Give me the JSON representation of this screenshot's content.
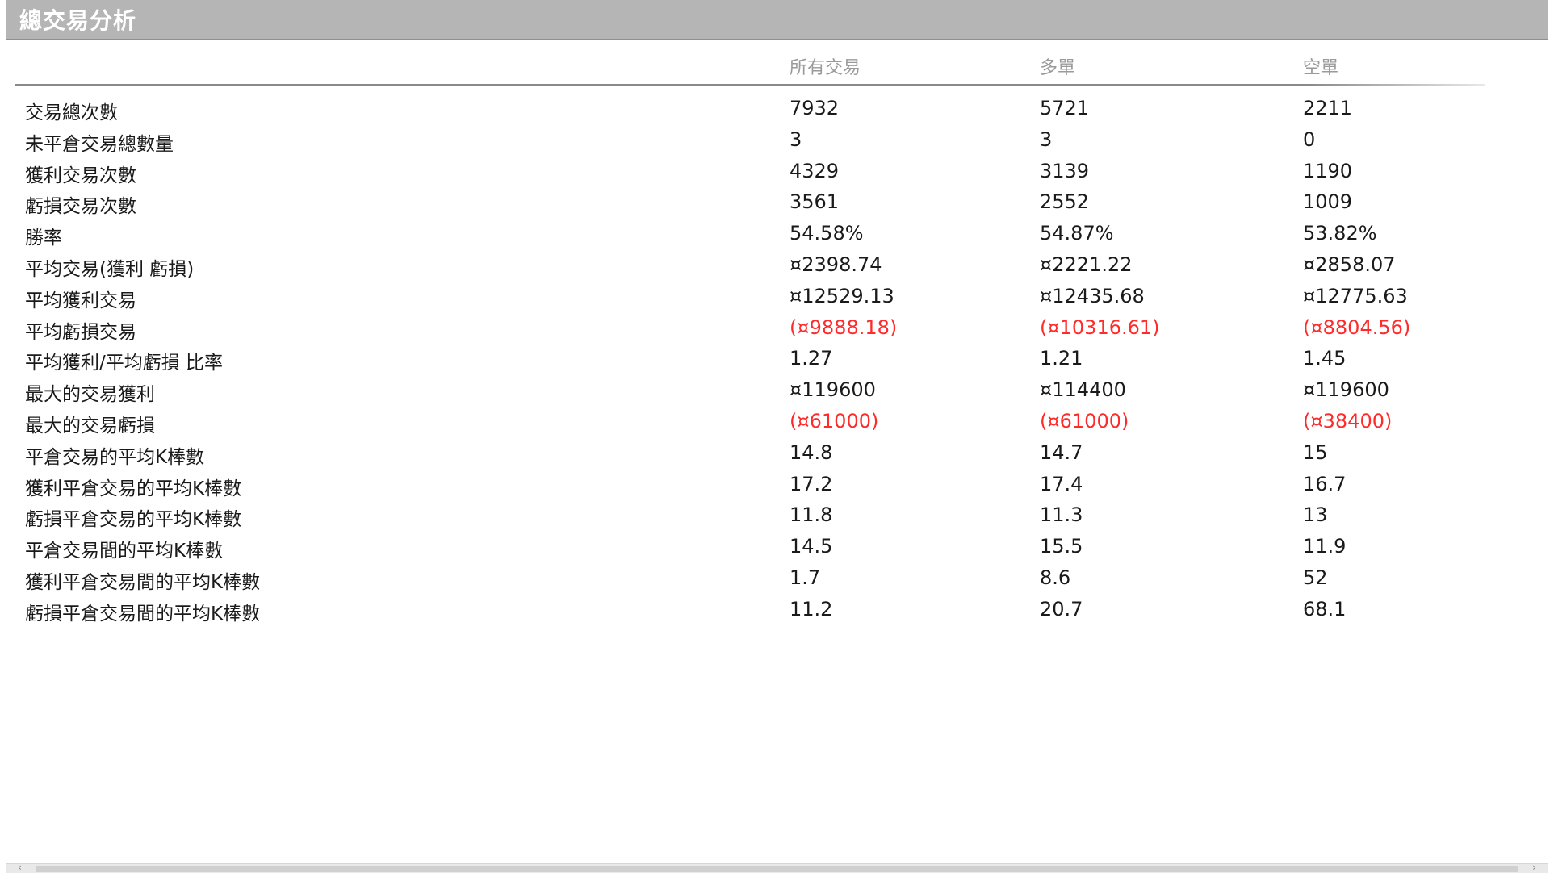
{
  "window": {
    "title": "總交易分析"
  },
  "table": {
    "headers": [
      "",
      "所有交易",
      "多單",
      "空單"
    ],
    "rows": [
      {
        "label": "交易總次數",
        "values": [
          "7932",
          "5721",
          "2211"
        ],
        "negative": false
      },
      {
        "label": "未平倉交易總數量",
        "values": [
          "3",
          "3",
          "0"
        ],
        "negative": false
      },
      {
        "label": "獲利交易次數",
        "values": [
          "4329",
          "3139",
          "1190"
        ],
        "negative": false
      },
      {
        "label": "虧損交易次數",
        "values": [
          "3561",
          "2552",
          "1009"
        ],
        "negative": false
      },
      {
        "label": "勝率",
        "values": [
          "54.58%",
          "54.87%",
          "53.82%"
        ],
        "negative": false
      },
      {
        "label": "平均交易(獲利 虧損)",
        "values": [
          "¤2398.74",
          "¤2221.22",
          "¤2858.07"
        ],
        "negative": false
      },
      {
        "label": "平均獲利交易",
        "values": [
          "¤12529.13",
          "¤12435.68",
          "¤12775.63"
        ],
        "negative": false
      },
      {
        "label": "平均虧損交易",
        "values": [
          "(¤9888.18)",
          "(¤10316.61)",
          "(¤8804.56)"
        ],
        "negative": true
      },
      {
        "label": "平均獲利/平均虧損 比率",
        "values": [
          "1.27",
          "1.21",
          "1.45"
        ],
        "negative": false
      },
      {
        "label": "最大的交易獲利",
        "values": [
          "¤119600",
          "¤114400",
          "¤119600"
        ],
        "negative": false
      },
      {
        "label": "最大的交易虧損",
        "values": [
          "(¤61000)",
          "(¤61000)",
          "(¤38400)"
        ],
        "negative": true
      },
      {
        "label": "平倉交易的平均K棒數",
        "values": [
          "14.8",
          "14.7",
          "15"
        ],
        "negative": false
      },
      {
        "label": "獲利平倉交易的平均K棒數",
        "values": [
          "17.2",
          "17.4",
          "16.7"
        ],
        "negative": false
      },
      {
        "label": "虧損平倉交易的平均K棒數",
        "values": [
          "11.8",
          "11.3",
          "13"
        ],
        "negative": false
      },
      {
        "label": "平倉交易間的平均K棒數",
        "values": [
          "14.5",
          "15.5",
          "11.9"
        ],
        "negative": false
      },
      {
        "label": "獲利平倉交易間的平均K棒數",
        "values": [
          "1.7",
          "8.6",
          "52"
        ],
        "negative": false
      },
      {
        "label": "虧損平倉交易間的平均K棒數",
        "values": [
          "11.2",
          "20.7",
          "68.1"
        ],
        "negative": false
      }
    ]
  },
  "colors": {
    "titlebar": "#b5b5b5",
    "negative": "#ff2b2b",
    "header_text": "#9a9a9a"
  },
  "icons": {
    "scroll_left": "chevron-left-icon",
    "scroll_right": "chevron-right-icon"
  }
}
